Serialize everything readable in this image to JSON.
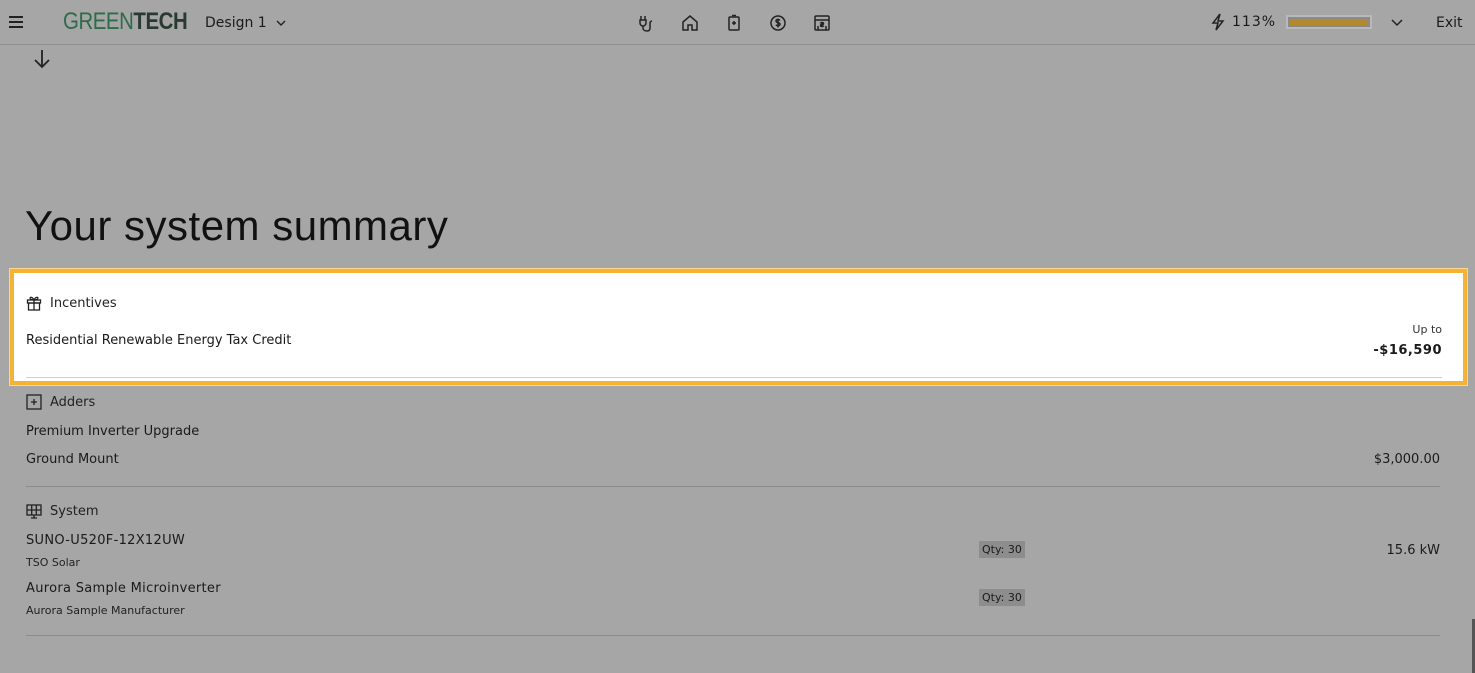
{
  "header": {
    "brand_green": "GREEN",
    "brand_tech": "TECH",
    "design_label": "Design 1",
    "nav_icons": [
      "plug-icon",
      "home-icon",
      "battery-icon",
      "dollar-icon",
      "finance-icon"
    ],
    "energy_offset": "113%",
    "energy_progress": 1.0,
    "exit_label": "Exit"
  },
  "page": {
    "title": "Your system summary"
  },
  "incentives": {
    "heading": "Incentives",
    "item_label": "Residential Renewable Energy Tax Credit",
    "upto_label": "Up to",
    "amount": "-$16,590"
  },
  "adders": {
    "heading": "Adders",
    "items": [
      {
        "label": "Premium Inverter Upgrade",
        "price": ""
      },
      {
        "label": "Ground Mount",
        "price": "$3,000.00"
      }
    ]
  },
  "system": {
    "heading": "System",
    "items": [
      {
        "name": "SUNO-U520F-12X12UW",
        "manufacturer": "TSO Solar",
        "qty": "Qty: 30",
        "size": "15.6 kW"
      },
      {
        "name": "Aurora Sample Microinverter",
        "manufacturer": "Aurora Sample Manufacturer",
        "qty": "Qty: 30",
        "size": ""
      }
    ]
  },
  "colors": {
    "accent_highlight": "#f5b335",
    "brand_green": "#2e6b4a",
    "energy_bar": "#b38a2e"
  }
}
